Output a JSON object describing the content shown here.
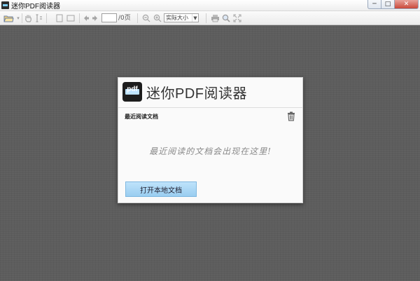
{
  "window": {
    "title": "迷你PDF阅读器",
    "controls": {
      "minimize": "─",
      "maximize": "□",
      "close": "✕"
    }
  },
  "toolbar": {
    "page_value": "",
    "page_total": "/0页",
    "zoom_value": "实际大小",
    "zoom_arrow": "▼",
    "icons": [
      "open-folder-icon",
      "hand-tool-icon",
      "text-select-icon",
      "single-page-icon",
      "two-page-icon",
      "prev-page-icon",
      "next-page-icon",
      "zoom-out-icon",
      "zoom-in-icon",
      "print-icon",
      "search-icon",
      "fullscreen-icon"
    ]
  },
  "panel": {
    "logo_text": "pdf",
    "brand": "迷你PDF阅读器",
    "recent_title": "最近阅读文档",
    "empty_message": "最近阅读的文档会出现在这里!",
    "open_button": "打开本地文档"
  }
}
